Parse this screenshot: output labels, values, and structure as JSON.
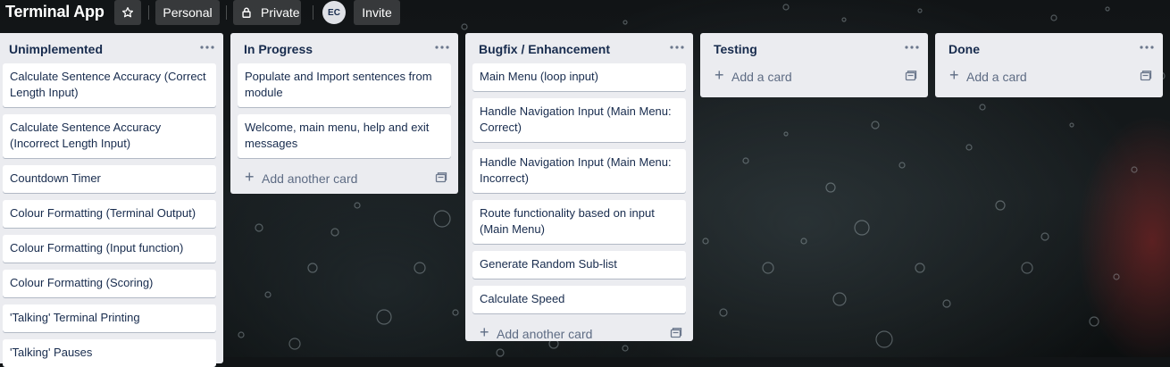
{
  "header": {
    "board_title": "Terminal App",
    "visibility_workspace": "Personal",
    "visibility": "Private",
    "member_initials": "EC",
    "invite_label": "Invite"
  },
  "lists": [
    {
      "title": "Unimplemented",
      "cards": [
        "Calculate Sentence Accuracy (Correct Length Input)",
        "Calculate Sentence Accuracy (Incorrect Length Input)",
        "Countdown Timer",
        "Colour Formatting (Terminal Output)",
        "Colour Formatting (Input function)",
        "Colour Formatting (Scoring)",
        "'Talking' Terminal Printing",
        "'Talking' Pauses"
      ]
    },
    {
      "title": "In Progress",
      "cards": [
        "Populate and Import sentences from module",
        "Welcome, main menu, help and exit messages"
      ],
      "add_label": "Add another card"
    },
    {
      "title": "Bugfix / Enhancement",
      "cards": [
        "Main Menu (loop input)",
        "Handle Navigation Input (Main Menu: Correct)",
        "Handle Navigation Input (Main Menu: Incorrect)",
        "Route functionality based on input (Main Menu)",
        "Generate Random Sub-list",
        "Calculate Speed"
      ],
      "add_label": "Add another card"
    },
    {
      "title": "Testing",
      "cards": [],
      "add_label": "Add a card"
    },
    {
      "title": "Done",
      "cards": [],
      "add_label": "Add a card"
    }
  ]
}
